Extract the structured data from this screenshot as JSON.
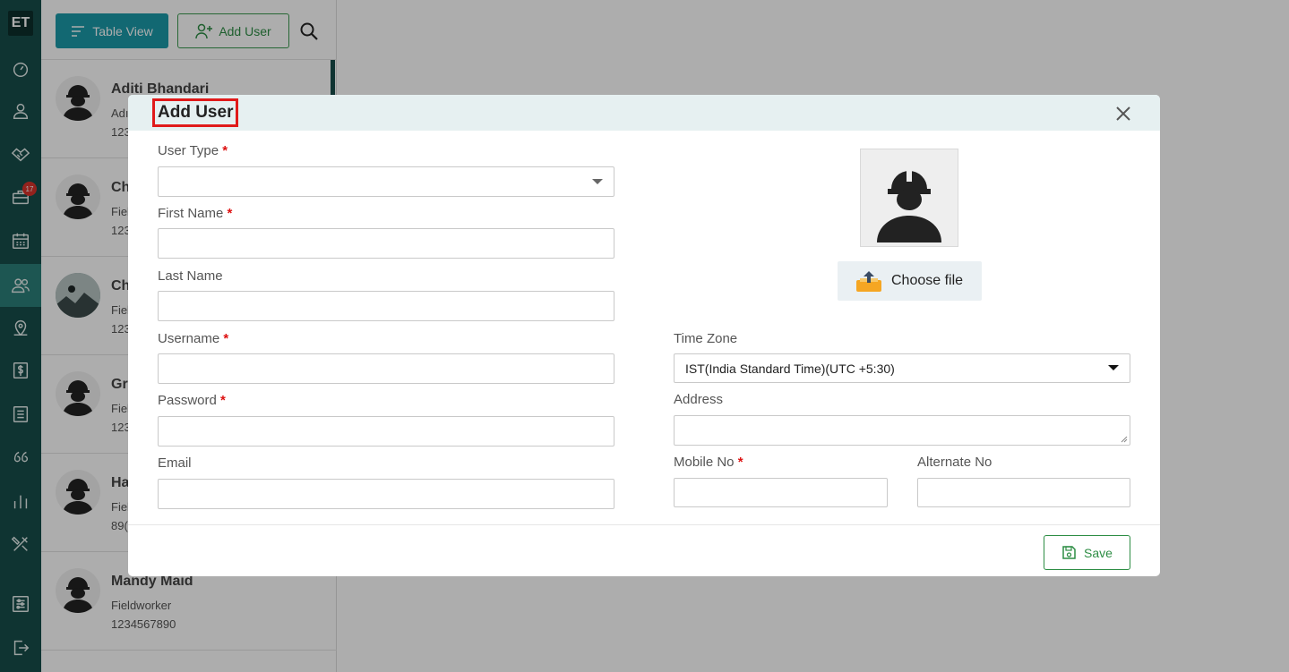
{
  "app": {
    "logo": "ET"
  },
  "sidebar": {
    "items": [
      {
        "icon": "dashboard-icon"
      },
      {
        "icon": "user-icon"
      },
      {
        "icon": "handshake-icon"
      },
      {
        "icon": "briefcase-icon",
        "badge": "17"
      },
      {
        "icon": "calendar-icon"
      },
      {
        "icon": "users-icon",
        "active": true
      },
      {
        "icon": "map-pin-icon"
      },
      {
        "icon": "dollar-icon"
      },
      {
        "icon": "list-icon"
      },
      {
        "icon": "quote-icon"
      },
      {
        "icon": "bar-chart-icon"
      },
      {
        "icon": "tools-icon"
      },
      {
        "icon": "settings-icon"
      },
      {
        "icon": "logout-icon"
      }
    ]
  },
  "toolbar": {
    "table_view_label": "Table View",
    "add_user_label": "Add User"
  },
  "users": [
    {
      "name": "Aditi Bhandari",
      "role": "Adı",
      "phone": "123"
    },
    {
      "name": "Ch",
      "role": "Fiel",
      "phone": "123"
    },
    {
      "name": "Ch",
      "role": "Fiel",
      "phone": "123"
    },
    {
      "name": "Gr",
      "role": "Fiel",
      "phone": "123"
    },
    {
      "name": "Ha",
      "role": "Fiel",
      "phone": "89("
    },
    {
      "name": "Mandy Maid",
      "role": "Fieldworker",
      "phone": "1234567890"
    }
  ],
  "modal": {
    "title": "Add User",
    "fields": {
      "user_type": {
        "label": "User Type",
        "value": ""
      },
      "first_name": {
        "label": "First Name",
        "value": ""
      },
      "last_name": {
        "label": "Last Name",
        "value": ""
      },
      "username": {
        "label": "Username",
        "value": ""
      },
      "password": {
        "label": "Password",
        "value": ""
      },
      "email": {
        "label": "Email",
        "value": ""
      },
      "time_zone": {
        "label": "Time Zone",
        "value": "IST(India Standard Time)(UTC +5:30)"
      },
      "address": {
        "label": "Address",
        "value": ""
      },
      "mobile_no": {
        "label": "Mobile No",
        "value": ""
      },
      "alternate_no": {
        "label": "Alternate No",
        "value": ""
      }
    },
    "required_marker": "*",
    "choose_file_label": "Choose file",
    "save_label": "Save"
  },
  "colors": {
    "sidebar": "#174d4a",
    "accent": "#1b9aa9",
    "success": "#2d8d44",
    "required": "#dd1111",
    "highlight_border": "#e01a1a"
  }
}
